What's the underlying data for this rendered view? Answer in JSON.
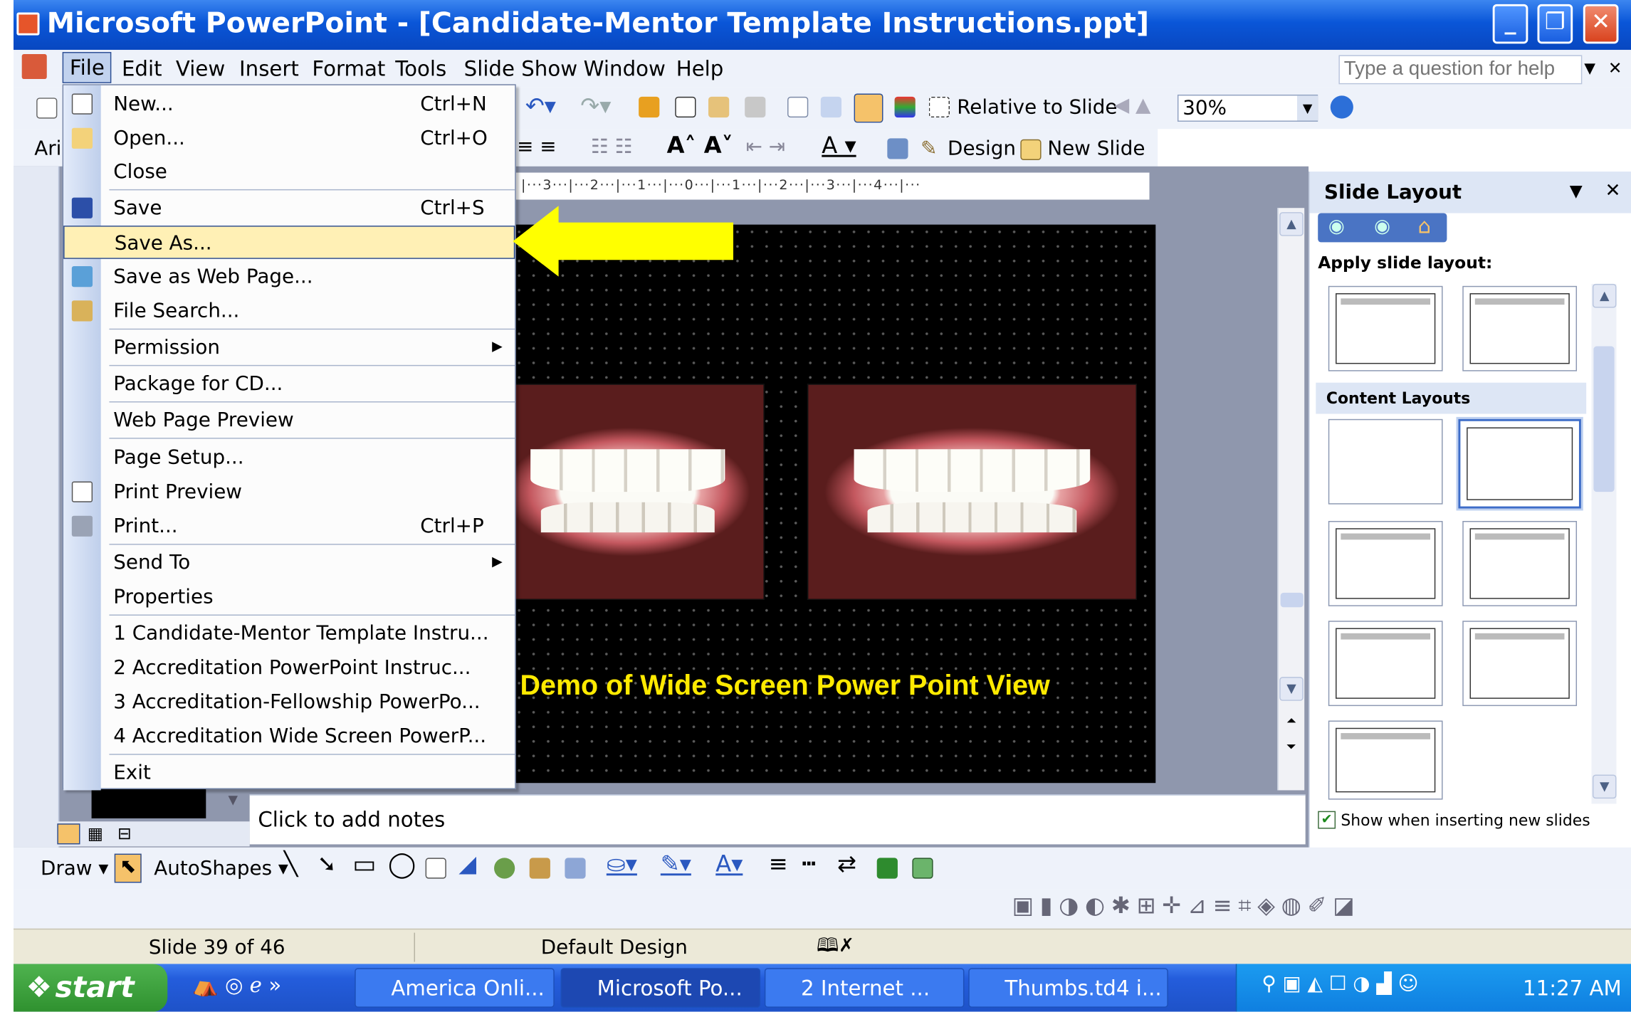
{
  "window": {
    "title": "Microsoft PowerPoint - [Candidate-Mentor Template Instructions.ppt]"
  },
  "menubar": {
    "items": [
      "File",
      "Edit",
      "View",
      "Insert",
      "Format",
      "Tools",
      "Slide Show",
      "Window",
      "Help"
    ]
  },
  "help": {
    "placeholder": "Type a question for help"
  },
  "toolbar": {
    "relative": "Relative to Slide",
    "zoom": "30%",
    "font": "Ari",
    "design": "Design",
    "new_slide": "New Slide"
  },
  "ruler": {
    "text": "|···3···|···2···|···1···|···0···|···1···|···2···|···3···|···4···|···"
  },
  "slide": {
    "caption": "Demo of Wide Screen Power Point View"
  },
  "file_menu": {
    "items": [
      {
        "label": "New...",
        "shortcut": "Ctrl+N"
      },
      {
        "label": "Open...",
        "shortcut": "Ctrl+O"
      },
      {
        "label": "Close",
        "shortcut": ""
      },
      {
        "label": "Save",
        "shortcut": "Ctrl+S"
      },
      {
        "label": "Save As...",
        "shortcut": ""
      },
      {
        "label": "Save as Web Page...",
        "shortcut": ""
      },
      {
        "label": "File Search...",
        "shortcut": ""
      },
      {
        "label": "Permission",
        "shortcut": ""
      },
      {
        "label": "Package for CD...",
        "shortcut": ""
      },
      {
        "label": "Web Page Preview",
        "shortcut": ""
      },
      {
        "label": "Page Setup...",
        "shortcut": ""
      },
      {
        "label": "Print Preview",
        "shortcut": ""
      },
      {
        "label": "Print...",
        "shortcut": "Ctrl+P"
      },
      {
        "label": "Send To",
        "shortcut": ""
      },
      {
        "label": "Properties",
        "shortcut": ""
      },
      {
        "label": "1 Candidate-Mentor Template Instru...",
        "shortcut": ""
      },
      {
        "label": "2 Accreditation PowerPoint Instruc...",
        "shortcut": ""
      },
      {
        "label": "3 Accreditation-Fellowship PowerPo...",
        "shortcut": ""
      },
      {
        "label": "4 Accreditation Wide Screen PowerP...",
        "shortcut": ""
      },
      {
        "label": "Exit",
        "shortcut": ""
      }
    ],
    "highlighted": "Save As..."
  },
  "notes": {
    "placeholder": "Click to add notes"
  },
  "task_pane": {
    "title": "Slide Layout",
    "apply_label": "Apply slide layout:",
    "section": "Content Layouts",
    "show_checkbox": "Show when inserting new slides",
    "show_checked": true
  },
  "drawbar": {
    "draw": "Draw",
    "autoshapes": "AutoShapes"
  },
  "status": {
    "slide": "Slide 39 of 46",
    "design": "Default Design"
  },
  "taskbar": {
    "start": "start",
    "tasks": [
      "America  Onli...",
      "Microsoft Po...",
      "2 Internet ...",
      "Thumbs.td4 i..."
    ],
    "clock": "11:27 AM"
  },
  "colors": {
    "title_blue": "#0a56d8",
    "highlight": "#fff0b5",
    "arrow": "#ffff00",
    "caption": "#ffea00"
  }
}
